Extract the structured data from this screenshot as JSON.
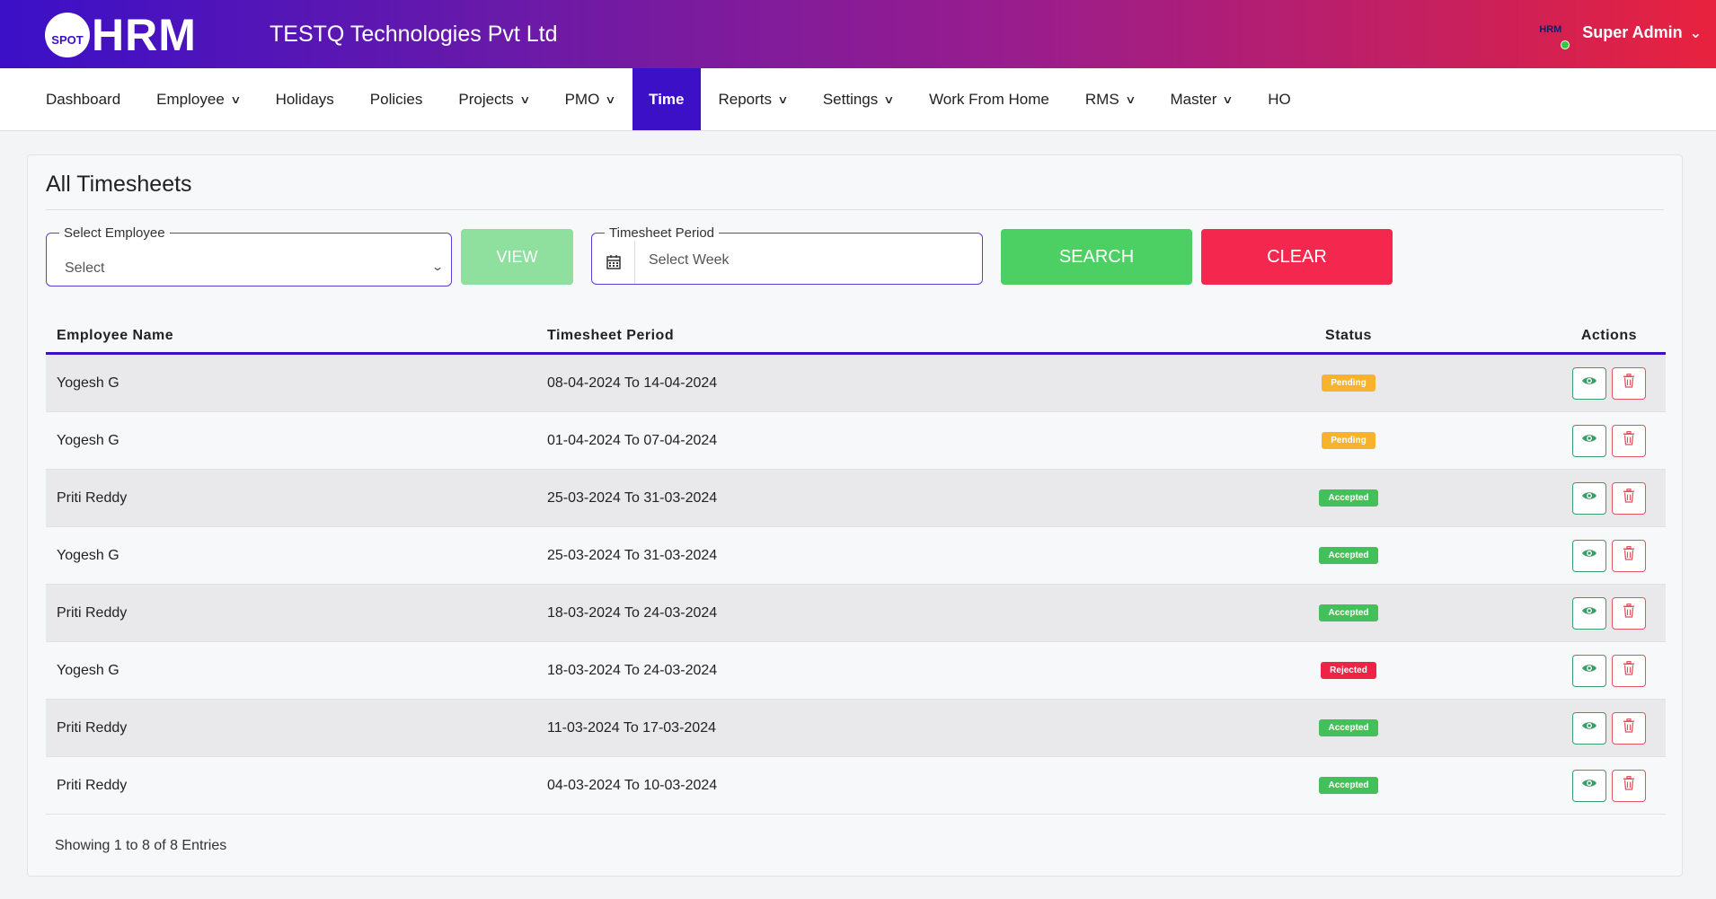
{
  "header": {
    "logo_badge": "SPOT",
    "logo_text": "HRM",
    "company": "TESTQ Technologies Pvt Ltd",
    "avatar_text": "HRM",
    "user_name": "Super Admin",
    "status_color": "#2ecc40"
  },
  "nav": [
    {
      "label": "Dashboard",
      "dropdown": false
    },
    {
      "label": "Employee",
      "dropdown": true
    },
    {
      "label": "Holidays",
      "dropdown": false
    },
    {
      "label": "Policies",
      "dropdown": false
    },
    {
      "label": "Projects",
      "dropdown": true
    },
    {
      "label": "PMO",
      "dropdown": true
    },
    {
      "label": "Time",
      "dropdown": false,
      "active": true
    },
    {
      "label": "Reports",
      "dropdown": true
    },
    {
      "label": "Settings",
      "dropdown": true
    },
    {
      "label": "Work From Home",
      "dropdown": false
    },
    {
      "label": "RMS",
      "dropdown": true
    },
    {
      "label": "Master",
      "dropdown": true
    },
    {
      "label": "HO",
      "dropdown": false
    }
  ],
  "page": {
    "title": "All Timesheets",
    "employee_label": "Select Employee",
    "employee_value": "Select",
    "view_label": "VIEW",
    "period_label": "Timesheet Period",
    "period_placeholder": "Select Week",
    "search_label": "SEARCH",
    "clear_label": "CLEAR"
  },
  "table": {
    "columns": [
      "Employee Name",
      "Timesheet Period",
      "Status",
      "Actions"
    ],
    "rows": [
      {
        "name": "Yogesh G",
        "period": "08-04-2024 To 14-04-2024",
        "status": "Pending"
      },
      {
        "name": "Yogesh G",
        "period": "01-04-2024 To 07-04-2024",
        "status": "Pending"
      },
      {
        "name": "Priti Reddy",
        "period": "25-03-2024 To 31-03-2024",
        "status": "Accepted"
      },
      {
        "name": "Yogesh G",
        "period": "25-03-2024 To 31-03-2024",
        "status": "Accepted"
      },
      {
        "name": "Priti Reddy",
        "period": "18-03-2024 To 24-03-2024",
        "status": "Accepted"
      },
      {
        "name": "Yogesh G",
        "period": "18-03-2024 To 24-03-2024",
        "status": "Rejected"
      },
      {
        "name": "Priti Reddy",
        "period": "11-03-2024 To 17-03-2024",
        "status": "Accepted"
      },
      {
        "name": "Priti Reddy",
        "period": "04-03-2024 To 10-03-2024",
        "status": "Accepted"
      }
    ],
    "footer": "Showing 1 to 8 of 8 Entries"
  },
  "colors": {
    "primary": "#3b10c7",
    "search": "#4cd064",
    "clear": "#f4284e",
    "pending": "#f8b32d",
    "accepted": "#43c05a",
    "rejected": "#ee2346"
  }
}
